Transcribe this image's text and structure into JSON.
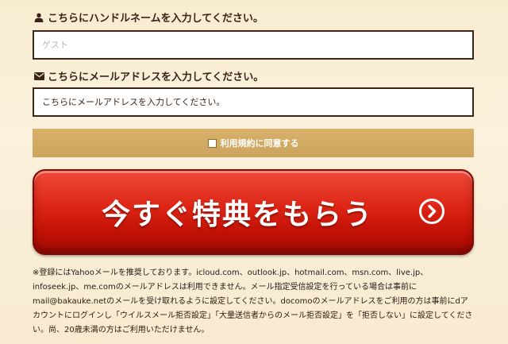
{
  "form": {
    "name_label": "こちらにハンドルネームを入力してください。",
    "name_placeholder": "ゲスト",
    "email_label": "こちらにメールアドレスを入力してください。",
    "email_placeholder": "こちらにメールアドレスを入力してください。",
    "terms_label": "利用規約に同意する",
    "terms_checked": false
  },
  "cta": {
    "label": "今すぐ特典をもらう"
  },
  "notice": "※登録にはYahooメールを推奨しております。icloud.com、outlook.jp、hotmail.com、msn.com、live.jp、infoseek.jp、me.comのメールアドレスは利用できません。メール指定受信設定を行っている場合は事前にmail@bakauke.netのメールを受け取れるように設定してください。docomoのメールアドレスをご利用の方は事前にdアカウントにログインし「ウイルスメール拒否設定」「大量送信者からのメール拒否設定」を「拒否しない」に設定してください。尚、20歳未満の方はご利用いただけません。",
  "icons": {
    "name": "user-icon",
    "email": "envelope-icon",
    "cta": "chevron-right-circle-icon"
  },
  "colors": {
    "cta_red": "#d9230f",
    "terms_gold": "#d3ab64",
    "text_dark": "#3a2418"
  }
}
